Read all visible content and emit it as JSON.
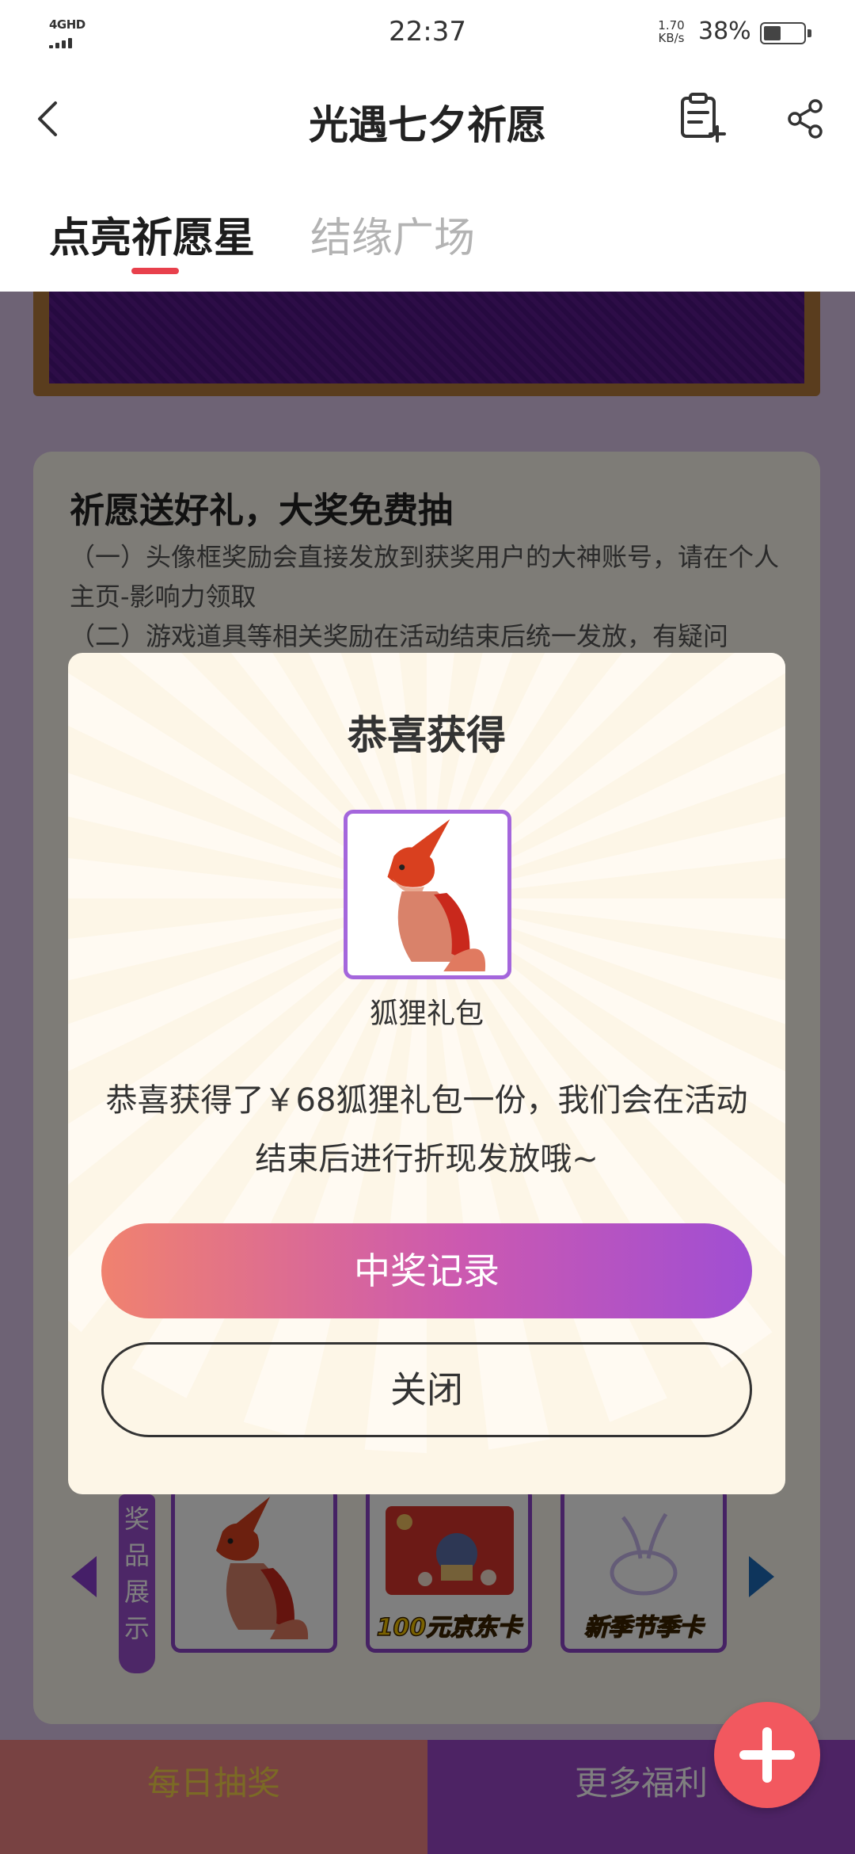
{
  "status_bar": {
    "network": "4GHD",
    "time": "22:37",
    "speed_value": "1.70",
    "speed_unit": "KB/s",
    "battery_percent": "38%",
    "battery_level": 0.38
  },
  "header": {
    "title": "光遇七夕祈愿",
    "back_icon": "chevron-left-icon",
    "note_icon": "note-add-icon",
    "share_icon": "share-icon"
  },
  "tabs": [
    {
      "label": "点亮祈愿星",
      "active": true
    },
    {
      "label": "结缘广场",
      "active": false
    }
  ],
  "rules": {
    "title": "祈愿送好礼，大奖免费抽",
    "lines": [
      "（一）头像框奖励会直接发放到获奖用户的大神账号，请在个人主页-影响力领取",
      "（二）游戏道具等相关奖励在活动结束后统一发放，有疑问"
    ]
  },
  "prizes": {
    "label": "奖品展示",
    "items": [
      {
        "caption": "",
        "icon": "fox-icon"
      },
      {
        "caption": "100元京东卡",
        "icon": "jd-card-icon"
      },
      {
        "caption": "新季节季卡",
        "icon": "rabbit-icon"
      }
    ]
  },
  "bottom_bar": {
    "left": "每日抽奖",
    "right": "更多福利"
  },
  "modal": {
    "title": "恭喜获得",
    "prize_name": "狐狸礼包",
    "message": "恭喜获得了￥68狐狸礼包一份，我们会在活动结束后进行折现发放哦~",
    "primary_button": "中奖记录",
    "secondary_button": "关闭"
  },
  "colors": {
    "accent_red": "#e8404c",
    "modal_bg": "#fdf6e7",
    "gradient_start": "#f0826f",
    "gradient_end": "#a04ed3",
    "fab": "#f2585f"
  }
}
